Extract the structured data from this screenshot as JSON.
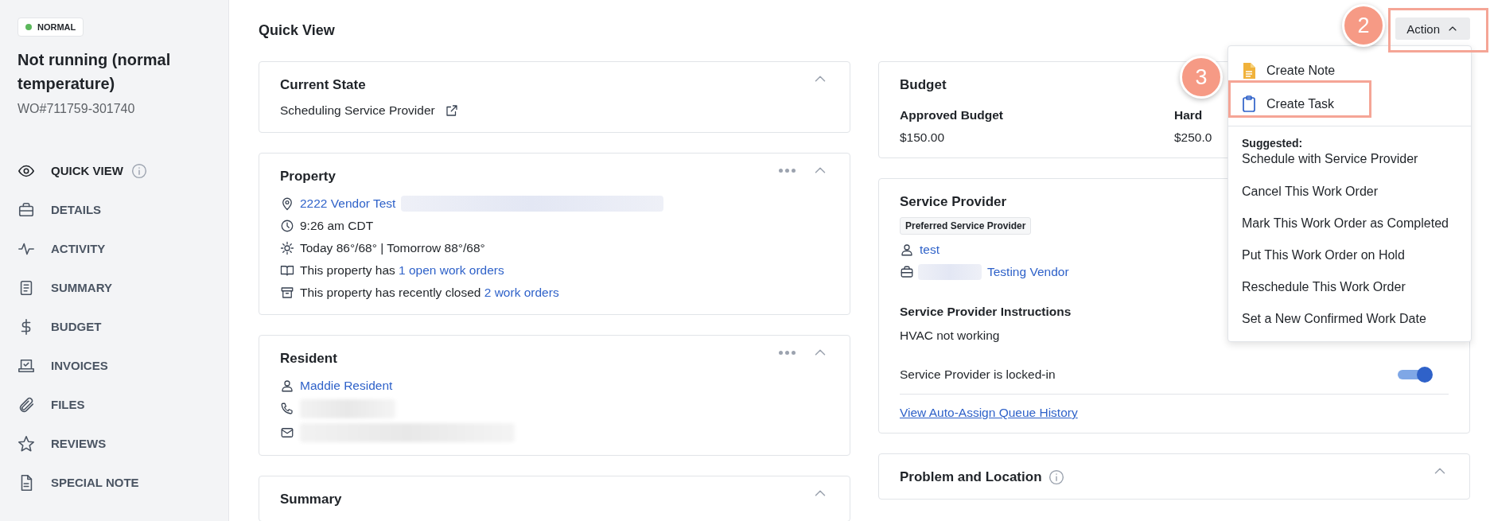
{
  "sidebar": {
    "status_badge": {
      "label": "NORMAL",
      "color": "#5cb85c"
    },
    "title": "Not running (normal temperature)",
    "work_order": "WO#711759-301740",
    "nav": [
      {
        "label": "QUICK VIEW",
        "selected": true,
        "info": true
      },
      {
        "label": "DETAILS",
        "selected": false
      },
      {
        "label": "ACTIVITY",
        "selected": false
      },
      {
        "label": "SUMMARY",
        "selected": false
      },
      {
        "label": "BUDGET",
        "selected": false
      },
      {
        "label": "INVOICES",
        "selected": false
      },
      {
        "label": "FILES",
        "selected": false
      },
      {
        "label": "REVIEWS",
        "selected": false
      },
      {
        "label": "SPECIAL NOTE",
        "selected": false
      }
    ]
  },
  "page_title": "Quick View",
  "action_button": {
    "label": "Action",
    "expanded": true
  },
  "action_menu": {
    "items": [
      {
        "label": "Create Note",
        "kind": "note"
      },
      {
        "label": "Create Task",
        "kind": "task"
      }
    ],
    "suggested_label": "Suggested:",
    "suggested": [
      "Schedule with Service Provider",
      "Cancel This Work Order",
      "Mark This Work Order as Completed",
      "Put This Work Order on Hold",
      "Reschedule This Work Order",
      "Set a New Confirmed Work Date"
    ]
  },
  "annotations": [
    {
      "label": "2"
    },
    {
      "label": "3"
    }
  ],
  "left_column": [
    {
      "kind": "state",
      "title": "Current State",
      "expanded": true,
      "text": "Scheduling Service Provider"
    },
    {
      "kind": "rows",
      "title": "Property",
      "expanded": true,
      "more": true,
      "rows": [
        {
          "kind": "address",
          "link": "2222 Vendor Test",
          "redacted": true
        },
        {
          "kind": "time",
          "text": "9:26 am CDT"
        },
        {
          "kind": "weather",
          "text": "Today 86°/68° | Tomorrow 88°/68°"
        },
        {
          "kind": "open_orders",
          "text": "This property has ",
          "link": "1 open work orders"
        },
        {
          "kind": "closed_orders",
          "text": "This property has recently closed ",
          "link": "2 work orders"
        }
      ]
    },
    {
      "kind": "rows",
      "title": "Resident",
      "expanded": true,
      "more": true,
      "rows": [
        {
          "kind": "person",
          "link": "Maddie Resident"
        },
        {
          "kind": "phone",
          "redacted": true
        },
        {
          "kind": "email",
          "redacted": true
        }
      ]
    },
    {
      "kind": "title",
      "title": "Summary",
      "expanded": true
    }
  ],
  "right_column": [
    {
      "kind": "budget",
      "title": "Budget",
      "fields": [
        {
          "label": "Approved Budget",
          "value": "$150.00"
        },
        {
          "label": "Hard",
          "value": "$250.0"
        }
      ]
    },
    {
      "kind": "provider",
      "title": "Service Provider",
      "tag": "Preferred Service Provider",
      "rows": [
        {
          "kind": "person",
          "link": "test"
        },
        {
          "kind": "company",
          "link": "Testing Vendor",
          "redacted": true
        }
      ],
      "instructions_title": "Service Provider Instructions",
      "instructions": "HVAC not working",
      "lock": {
        "label": "Service Provider is locked-in",
        "on": true
      },
      "history_link": "View Auto-Assign Queue History"
    },
    {
      "kind": "title",
      "title": "Problem and Location",
      "info": true,
      "expanded": true
    }
  ]
}
